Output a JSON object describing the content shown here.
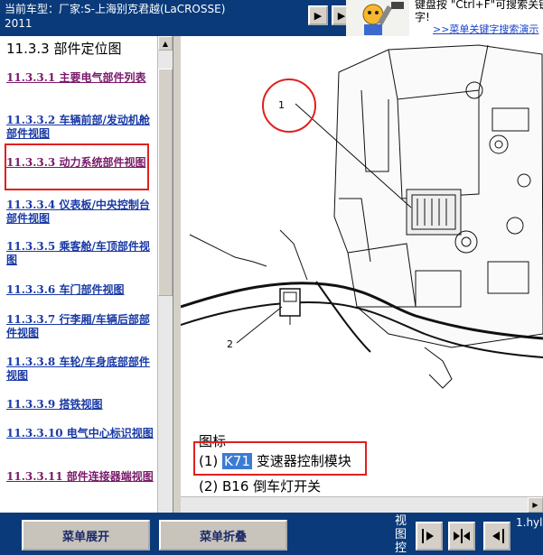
{
  "header": {
    "vehicle_line1": "当前车型：厂家:S-上海别克君越(LaCROSSE)",
    "vehicle_line2": "2011",
    "help_line1": "键盘按 \"Ctrl+F\"可搜索关键",
    "help_line2": "字!",
    "help_link": ">>菜单关键字搜索演示"
  },
  "toc": {
    "title": "11.3.3 部件定位图",
    "items": [
      {
        "label": "11.3.3.1 主要电气部件列表",
        "visited": true
      },
      {
        "label": "11.3.3.2 车辆前部/发动机舱部件视图",
        "visited": false
      },
      {
        "label": "11.3.3.3 动力系统部件视图",
        "visited": true
      },
      {
        "label": "11.3.3.4 仪表板/中央控制台部件视图",
        "visited": false
      },
      {
        "label": "11.3.3.5 乘客舱/车顶部件视图",
        "visited": false
      },
      {
        "label": "11.3.3.6 车门部件视图",
        "visited": false
      },
      {
        "label": "11.3.3.7 行李厢/车辆后部部件视图",
        "visited": false
      },
      {
        "label": "11.3.3.8 车轮/车身底部部件视图",
        "visited": false
      },
      {
        "label": "11.3.3.9 搭铁视图",
        "visited": false
      },
      {
        "label": "11.3.3.10 电气中心标识视图",
        "visited": false
      },
      {
        "label": "11.3.3.11 部件连接器端视图",
        "visited": true
      }
    ]
  },
  "diagram": {
    "callout_1": "1",
    "callout_2": "2"
  },
  "legend": {
    "title": "图标",
    "item1_prefix": "(1) ",
    "item1_code": "K71",
    "item1_text": " 变速器控制模块",
    "item2": "(2) B16 倒车灯开关"
  },
  "toolbar": {
    "expand_label": "菜单展开",
    "collapse_label": "菜单折叠",
    "view_control_label": "视图控",
    "file_name": "1.hyl"
  },
  "colors": {
    "header_bg": "#0a3a7a",
    "link": "#1a3aa6",
    "visited_link": "#7a1a6a",
    "highlight_box": "#e02020",
    "selection": "#3a7bd5"
  }
}
